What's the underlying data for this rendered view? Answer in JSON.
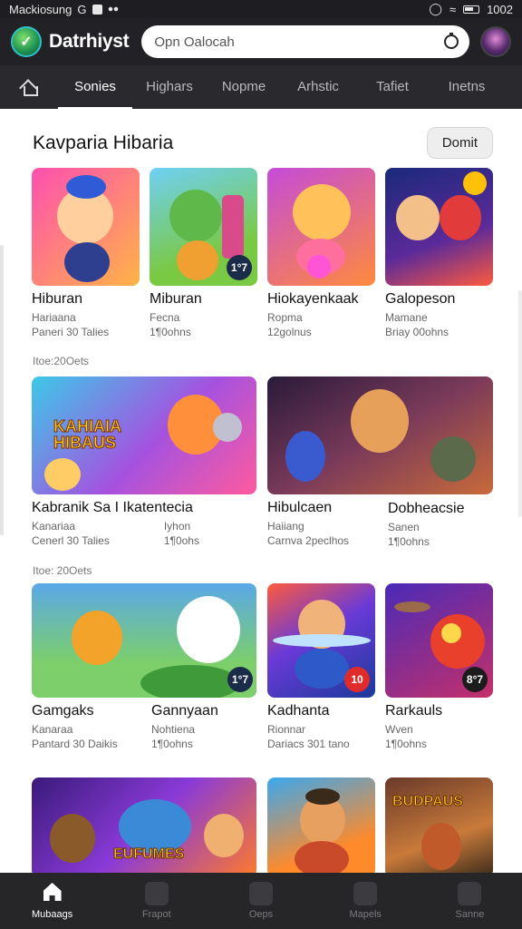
{
  "status": {
    "carrier": "Mackiosung",
    "g_label": "G",
    "time": "1002"
  },
  "appbar": {
    "title": "Datrhiyst",
    "search_placeholder": "Opn Oalocah"
  },
  "tabs": [
    "Sonies",
    "Highars",
    "Nopme",
    "Arhstic",
    "Tafiet",
    "Inetns"
  ],
  "section": {
    "title": "Kavparia Hibaria",
    "more_label": "Domit"
  },
  "row1": [
    {
      "title": "Hiburan",
      "sub": "Hariaana",
      "meta": "Paneri 30 Talies",
      "badge": ""
    },
    {
      "title": "Miburan",
      "sub": "Fecna",
      "meta": "1¶0ohns",
      "badge": "1°7"
    },
    {
      "title": "Hiokayenkaak",
      "sub": "Ropma",
      "meta": "12golnus",
      "badge": ""
    },
    {
      "title": "Galopeson",
      "sub": "Mamane",
      "meta": "Briay 00ohns",
      "badge": ""
    }
  ],
  "group1_label": "Itoe:20Oets",
  "row2": [
    {
      "title": "Kabranik Sa I Ikatentecia",
      "sub": "Kanariaa",
      "meta": "Cenerl 30 Talies",
      "badge": "",
      "banner": "KAHIAIA HIBAUS"
    },
    {
      "title": "Hibulcaen",
      "sub": "Haiiang",
      "meta": "Carnva 2peclhos",
      "badge": ""
    },
    {
      "title": "Dobheacsie",
      "sub": "Sanen",
      "meta": "1¶0ohns",
      "badge": ""
    }
  ],
  "row2_mid_sub": "Iyhon",
  "row2_mid_meta": "1¶0ohs",
  "group2_label": "Itoe: 20Oets",
  "row3": [
    {
      "title": "Gamgaks",
      "sub": "Kanaraa",
      "meta": "Pantard 30 Daikis",
      "badge": ""
    },
    {
      "title": "Gannyaan",
      "sub": "Nohtiena",
      "meta": "1¶0ohns",
      "badge": "1°7"
    },
    {
      "title": "Kadhanta",
      "sub": "Rionnar",
      "meta": "Dariacs 301 tano",
      "badge": "10"
    },
    {
      "title": "Rarkauls",
      "sub": "Wven",
      "meta": "1¶0ohns",
      "badge": "8°7"
    }
  ],
  "row4": [
    {
      "banner": "EUFUMES"
    },
    {
      "banner": ""
    },
    {
      "banner": "BUDPAUS"
    }
  ],
  "bottomnav": [
    {
      "label": "Mubaags",
      "active": true
    },
    {
      "label": "Frapot",
      "active": false
    },
    {
      "label": "Oeps",
      "active": false
    },
    {
      "label": "Mapels",
      "active": false
    },
    {
      "label": "Sanne",
      "active": false
    }
  ],
  "colors": {
    "appbar": "#222226",
    "tabbar": "#2a2a2e",
    "bottomnav": "#262629",
    "badge_red": "#e02b2b"
  }
}
